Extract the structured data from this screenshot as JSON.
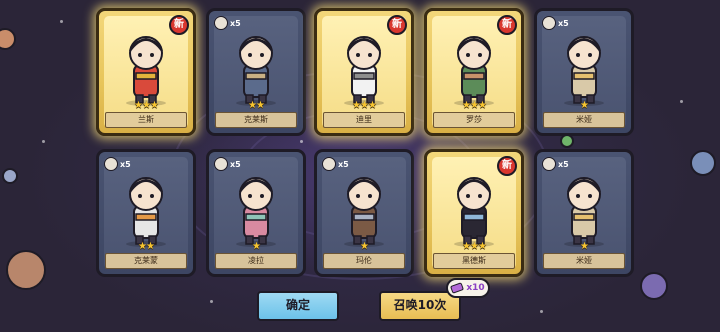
{
  "cards": [
    {
      "name": "兰斯",
      "stars": "★★★",
      "is_new": true,
      "new_label": "新",
      "shard_count": "",
      "figure": "golden-knight-figure",
      "palette": {
        "main": "#d94a3b",
        "accent": "#e4b33b"
      }
    },
    {
      "name": "克莱斯",
      "stars": "★★",
      "is_new": false,
      "new_label": "",
      "shard_count": "x5",
      "figure": "mounted-knight-figure",
      "palette": {
        "main": "#5b6b8c",
        "accent": "#c9b084"
      }
    },
    {
      "name": "迪里",
      "stars": "★★★",
      "is_new": true,
      "new_label": "新",
      "shard_count": "",
      "figure": "white-scholar-figure",
      "palette": {
        "main": "#f2f2f2",
        "accent": "#8e8e8e"
      }
    },
    {
      "name": "罗莎",
      "stars": "★★★",
      "is_new": true,
      "new_label": "新",
      "shard_count": "",
      "figure": "fox-girl-figure",
      "palette": {
        "main": "#5c8c59",
        "accent": "#c7926a"
      }
    },
    {
      "name": "米娅",
      "stars": "★",
      "is_new": false,
      "new_label": "",
      "shard_count": "x5",
      "figure": "nun-figure",
      "palette": {
        "main": "#d9c9a8",
        "accent": "#e5c06f"
      }
    },
    {
      "name": "克莱蒙",
      "stars": "★★",
      "is_new": false,
      "new_label": "",
      "shard_count": "x5",
      "figure": "rider-figure",
      "palette": {
        "main": "#e6e6e6",
        "accent": "#e59a47"
      }
    },
    {
      "name": "凌拉",
      "stars": "★",
      "is_new": false,
      "new_label": "",
      "shard_count": "x5",
      "figure": "pink-mage-figure",
      "palette": {
        "main": "#d98aa1",
        "accent": "#8fc4b8"
      }
    },
    {
      "name": "玛伦",
      "stars": "★",
      "is_new": false,
      "new_label": "",
      "shard_count": "x5",
      "figure": "swordsman-figure",
      "palette": {
        "main": "#7b5a45",
        "accent": "#aab3c4"
      }
    },
    {
      "name": "黑德斯",
      "stars": "★★★",
      "is_new": true,
      "new_label": "新",
      "shard_count": "",
      "figure": "dark-elf-figure",
      "palette": {
        "main": "#2a2733",
        "accent": "#8fb7d9"
      }
    },
    {
      "name": "米娅",
      "stars": "★",
      "is_new": false,
      "new_label": "",
      "shard_count": "x5",
      "figure": "nun-figure",
      "palette": {
        "main": "#d9c9a8",
        "accent": "#e5c06f"
      }
    }
  ],
  "buttons": {
    "confirm_label": "确定",
    "summon_label": "召唤10次",
    "summon_cost": "x10"
  },
  "colors": {
    "new_badge": "#d9372f",
    "star": "#f7c531",
    "confirm": "#6cc2e9",
    "summon": "#e8bd53"
  }
}
